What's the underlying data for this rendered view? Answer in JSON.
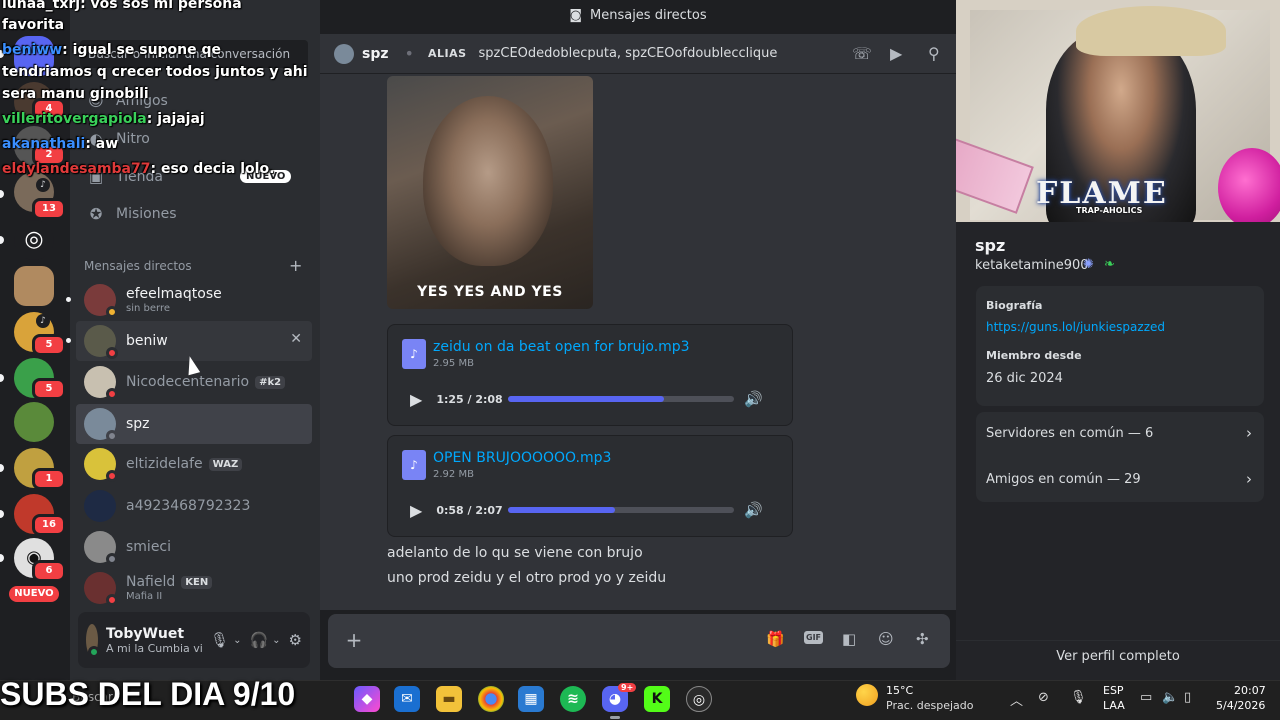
{
  "window": {
    "title": "Mensajes directos"
  },
  "sidebar": {
    "search_placeholder": "Buscar o iniciar una conversación",
    "nav": [
      {
        "label": "Amigos",
        "icon": "friends-icon"
      },
      {
        "label": "Nitro",
        "icon": "nitro-icon"
      },
      {
        "label": "Tienda",
        "icon": "shop-icon",
        "tag": "NUEVO"
      },
      {
        "label": "Misiones",
        "icon": "quests-icon"
      }
    ],
    "dm_header": "Mensajes directos",
    "dms": [
      {
        "name": "efeelmaqtose",
        "sub": "sin berre",
        "status": "dnd",
        "color": "#7a3b3b"
      },
      {
        "name": "beniw",
        "status": "dnd",
        "color": "#5a5a4a"
      },
      {
        "name": "Nicodecentenario",
        "tag": "#k2",
        "status": "dnd",
        "color": "#c8c0b0"
      },
      {
        "name": "spz",
        "status": "offline",
        "color": "#7a8a9a"
      },
      {
        "name": "eltizidelafe",
        "tag": "WAZ",
        "status": "dnd",
        "color": "#d9c23a"
      },
      {
        "name": "a4923468792323",
        "status": "none",
        "color": "#1e2a44"
      },
      {
        "name": "smieci",
        "status": "offline",
        "color": "#8a8a8a"
      },
      {
        "name": "Nafield",
        "tag": "KEN",
        "sub": "Mafia II",
        "status": "dnd",
        "color": "#6a3030"
      }
    ],
    "user": {
      "name": "TobyWuet",
      "status": "A mi la Cumbia villera"
    }
  },
  "rail": {
    "badges": [
      "4",
      "2",
      "13",
      "5",
      "5",
      "1",
      "16",
      "6"
    ],
    "new_label": "NUEVO",
    "colors": [
      "#5865f2",
      "#4a3a30",
      "#555",
      "#7a6a5a",
      "#222",
      "#b08a60",
      "#d9a33a",
      "#3aa04a",
      "#5a8a3a",
      "#c0a040",
      "#c0392b",
      "#e0e0e0"
    ]
  },
  "chat_header": {
    "name": "spz",
    "alias_label": "ALIAS",
    "aliases": "spzCEOdedoblecputa, spzCEOofdoublecclique"
  },
  "chat": {
    "gif_caption": "YES YES AND YES",
    "attachments": [
      {
        "name": "zeidu on da beat open for brujo.mp3",
        "size": "2.95 MB",
        "time": "1:25 / 2:08",
        "progress": 0.69
      },
      {
        "name": "OPEN BRUJOOOOOO.mp3",
        "size": "2.92 MB",
        "time": "0:58 / 2:07",
        "progress": 0.47
      }
    ],
    "lines": [
      "adelanto de lo qu se viene con brujo",
      "uno prod zeidu y el otro prod yo y zeidu"
    ]
  },
  "profile": {
    "banner_text": "FLAME",
    "banner_sub": "TRAP-AHOLICS",
    "name": "spz",
    "username": "ketaketamine900",
    "bio_label": "Biografía",
    "bio_link": "https://guns.lol/junkiespazzed",
    "member_since_label": "Miembro desde",
    "member_since": "26 dic 2024",
    "mutual_servers": "Servidores en común — 6",
    "mutual_friends": "Amigos en común — 29",
    "view_full": "Ver perfil completo"
  },
  "overlay": [
    {
      "user": "lunaa_txrj",
      "text": ": vos sos mi persona",
      "color": "#ffffff"
    },
    {
      "user": "",
      "text": "favorita",
      "color": "#ffffff"
    },
    {
      "user": "beniww",
      "text": ": igual se supone qe",
      "color": "#3a8fff"
    },
    {
      "user": "",
      "text": "tendriamos q crecer todos juntos y ahi",
      "color": "#ffffff"
    },
    {
      "user": "",
      "text": "sera manu ginobili",
      "color": "#ffffff"
    },
    {
      "user": "villeritovergapiola",
      "text": ": jajajaj",
      "color": "#3ad15a"
    },
    {
      "user": "akanathali",
      "text": ": aw",
      "color": "#3a8fff"
    },
    {
      "user": "eldylandesamba77",
      "text": ": eso decia lolo.",
      "color": "#e03a3a"
    }
  ],
  "taskbar": {
    "subs": "SUBS DEL DIA 9/10",
    "search": "Buscar",
    "temp": "15°C",
    "condition": "Prac. despejado",
    "lang1": "ESP",
    "lang2": "LAA",
    "time": "20:07",
    "date": "5/4/2026",
    "discord_badge": "9+"
  }
}
